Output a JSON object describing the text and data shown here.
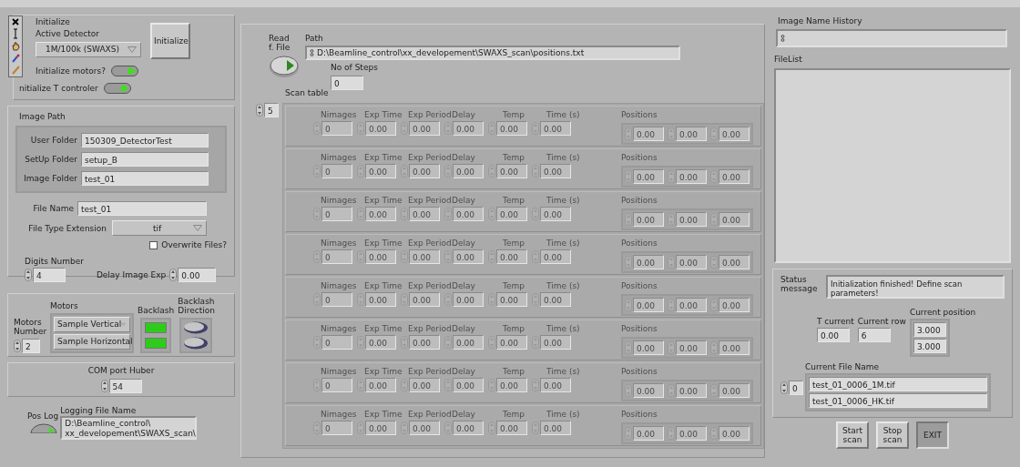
{
  "initialize": {
    "title": "Initialize",
    "detector_label": "Active Detector",
    "detector": "1M/100k (SWAXS)",
    "button": "Initialize",
    "switches": [
      {
        "label": "Initialize motors?",
        "on": true
      },
      {
        "label": "nitialize T controler",
        "on": true
      }
    ]
  },
  "image_path": {
    "title": "Image Path",
    "folders": [
      {
        "label": "User Folder",
        "value": "150309_DetectorTest"
      },
      {
        "label": "SetUp Folder",
        "value": "setup_B"
      },
      {
        "label": "Image Folder",
        "value": "test_01"
      }
    ],
    "file_name": {
      "label": "File Name",
      "value": "test_01"
    },
    "file_type": {
      "label": "File Type Extension",
      "value": "tif"
    },
    "overwrite": {
      "label": "Overwrite Files?",
      "checked": false
    },
    "digits": {
      "label": "Digits Number",
      "value": "4"
    },
    "delay": {
      "label": "Delay Image Exp",
      "value": "0.00"
    }
  },
  "motors": {
    "number_label": "Motors Number",
    "number": "2",
    "motors_label": "Motors",
    "backlash_label": "Backlash",
    "direction_label": "Backlash Direction",
    "rows": [
      {
        "motor": "Sample Vertical",
        "backlash": true,
        "direction": false
      },
      {
        "motor": "Sample Horizontal",
        "backlash": true,
        "direction": false
      }
    ]
  },
  "com_port": {
    "label": "COM port Huber",
    "value": "54"
  },
  "pos_log": {
    "label": "Pos Log",
    "on": true,
    "file_label": "Logging File Name",
    "file_lines": [
      "D:\\Beamline_control\\",
      "xx_developement\\SWAXS_scan\\"
    ]
  },
  "scan": {
    "read_label": "Read f. File",
    "read_on": true,
    "path_label": "Path",
    "path": "D:\\Beamline_control\\xx_developement\\SWAXS_scan\\positions.txt",
    "steps_label": "No of Steps",
    "steps": "0",
    "table_label": "Scan table",
    "index": "5",
    "disabled": true,
    "rows": [
      {
        "labels": [
          "Nimages",
          "Exp Time",
          "Exp Period",
          "Delay",
          "Temp",
          "Time (s)"
        ],
        "values": [
          "0",
          "0.00",
          "0.00",
          "0.00",
          "0.00",
          "0.00"
        ],
        "positions_label": "Positions",
        "positions": [
          "0.00",
          "0.00",
          "0.00"
        ]
      },
      {
        "labels": [
          "Nimages",
          "Exp Time",
          "Exp Period",
          "Delay",
          "Temp",
          "Time (s)"
        ],
        "values": [
          "0",
          "0.00",
          "0.00",
          "0.00",
          "0.00",
          "0.00"
        ],
        "positions_label": "Positions",
        "positions": [
          "0.00",
          "0.00",
          "0.00"
        ]
      },
      {
        "labels": [
          "Nimages",
          "Exp Time",
          "Exp Period",
          "Delay",
          "Temp",
          "Time (s)"
        ],
        "values": [
          "0",
          "0.00",
          "0.00",
          "0.00",
          "0.00",
          "0.00"
        ],
        "positions_label": "Positions",
        "positions": [
          "0.00",
          "0.00",
          "0.00"
        ]
      },
      {
        "labels": [
          "Nimages",
          "Exp Time",
          "Exp Period",
          "Delay",
          "Temp",
          "Time (s)"
        ],
        "values": [
          "0",
          "0.00",
          "0.00",
          "0.00",
          "0.00",
          "0.00"
        ],
        "positions_label": "Positions",
        "positions": [
          "0.00",
          "0.00",
          "0.00"
        ]
      },
      {
        "labels": [
          "Nimages",
          "Exp Time",
          "Exp Period",
          "Delay",
          "Temp",
          "Time (s)"
        ],
        "values": [
          "0",
          "0.00",
          "0.00",
          "0.00",
          "0.00",
          "0.00"
        ],
        "positions_label": "Positions",
        "positions": [
          "0.00",
          "0.00",
          "0.00"
        ]
      },
      {
        "labels": [
          "Nimages",
          "Exp Time",
          "Exp Period",
          "Delay",
          "Temp",
          "Time (s)"
        ],
        "values": [
          "0",
          "0.00",
          "0.00",
          "0.00",
          "0.00",
          "0.00"
        ],
        "positions_label": "Positions",
        "positions": [
          "0.00",
          "0.00",
          "0.00"
        ]
      },
      {
        "labels": [
          "Nimages",
          "Exp Time",
          "Exp Period",
          "Delay",
          "Temp",
          "Time (s)"
        ],
        "values": [
          "0",
          "0.00",
          "0.00",
          "0.00",
          "0.00",
          "0.00"
        ],
        "positions_label": "Positions",
        "positions": [
          "0.00",
          "0.00",
          "0.00"
        ]
      },
      {
        "labels": [
          "Nimages",
          "Exp Time",
          "Exp Period",
          "Delay",
          "Temp",
          "Time (s)"
        ],
        "values": [
          "0",
          "0.00",
          "0.00",
          "0.00",
          "0.00",
          "0.00"
        ],
        "positions_label": "Positions",
        "positions": [
          "0.00",
          "0.00",
          "0.00"
        ]
      }
    ]
  },
  "history": {
    "label": "Image Name History",
    "list_label": "FileList"
  },
  "status": {
    "label": "Status message",
    "message": "Initialization finished! Define scan parameters!",
    "t_label": "T current",
    "t": "0.00",
    "row_label": "Current row",
    "row": "6",
    "pos_label": "Current position",
    "positions": [
      "3.000",
      "3.000"
    ],
    "file_label": "Current File Name",
    "file_index": "0",
    "files": [
      "test_01_0006_1M.tif",
      "test_01_0006_HK.tif"
    ]
  },
  "buttons": [
    {
      "label": "Start scan",
      "kind": "normal"
    },
    {
      "label": "Stop scan",
      "kind": "normal"
    },
    {
      "label": "EXIT",
      "kind": "dark"
    }
  ]
}
